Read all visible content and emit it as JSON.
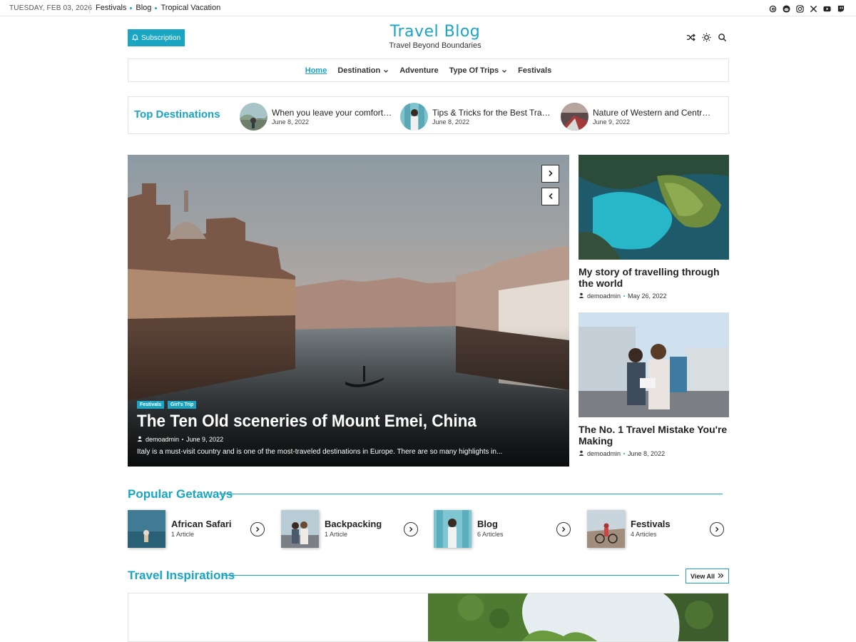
{
  "topbar": {
    "date": "TUESDAY, FEB 03, 2026",
    "links": [
      "Festivals",
      "Blog",
      "Tropical Vacation"
    ],
    "social_icons": [
      "threads-icon",
      "reddit-icon",
      "instagram-icon",
      "x-icon",
      "youtube-icon",
      "twitch-icon"
    ]
  },
  "header": {
    "subscription_label": "Subscription",
    "site_title": "Travel Blog",
    "tagline": "Travel Beyond Boundaries",
    "icons": [
      "shuffle-icon",
      "sun-icon",
      "search-icon"
    ]
  },
  "nav": {
    "items": [
      "Home",
      "Destination",
      "Adventure",
      "Type Of Trips",
      "Festivals"
    ],
    "active": "Home"
  },
  "top_destinations": {
    "label": "Top Destinations",
    "items": [
      {
        "title": "When you leave your comfort zone,...",
        "date": "June 8, 2022"
      },
      {
        "title": "Tips & Tricks for the Best Travel...",
        "date": "June 8, 2022"
      },
      {
        "title": "Nature of Western and Central...",
        "date": "June 9, 2022"
      }
    ]
  },
  "hero": {
    "tags": [
      "Festivals",
      "Girl's Trip"
    ],
    "title": "The Ten Old sceneries of Mount Emei, China",
    "author": "demoadmin",
    "date": "June 9, 2022",
    "excerpt": "Italy is a must-visit country and is one of the most-traveled destinations in Europe. There are so many highlights in..."
  },
  "side_posts": [
    {
      "title": "My story of travelling through the world",
      "author": "demoadmin",
      "date": "May 26, 2022"
    },
    {
      "title": "The No. 1 Travel Mistake You're Making",
      "author": "demoadmin",
      "date": "June 8, 2022"
    }
  ],
  "popular_getaways": {
    "title": "Popular Getaways",
    "items": [
      {
        "name": "African Safari",
        "count": "1 Article"
      },
      {
        "name": "Backpacking",
        "count": "1 Article"
      },
      {
        "name": "Blog",
        "count": "6 Articles"
      },
      {
        "name": "Festivals",
        "count": "4 Articles"
      }
    ]
  },
  "travel_inspirations": {
    "title": "Travel Inspirations",
    "view_all": "View All"
  },
  "colors": {
    "accent": "#1aa5c3",
    "text": "#222222",
    "border": "#e3e3e3"
  }
}
